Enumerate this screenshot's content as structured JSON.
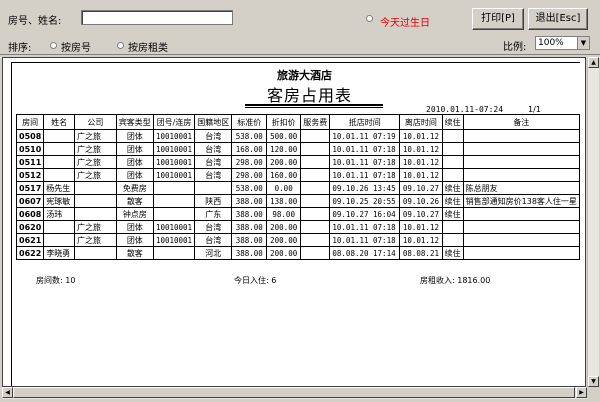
{
  "search": {
    "label": "房号、姓名:",
    "value": ""
  },
  "birthday": {
    "label": "今天过生日"
  },
  "buttons": {
    "print": "打印[P]",
    "exit": "退出[Esc]"
  },
  "sort": {
    "label": "排序:",
    "options": [
      {
        "label": "按房号",
        "selected": false
      },
      {
        "label": "按房租类",
        "selected": false
      }
    ]
  },
  "zoom": {
    "label": "比例:",
    "value": "100%"
  },
  "report": {
    "hotel_name": "旅游大酒店",
    "title": "客房占用表",
    "print_time": "2010.01.11-07:24",
    "page": "1/1",
    "columns": [
      "房间",
      "姓名",
      "公司",
      "宾客类型",
      "团号/连房",
      "国籍地区",
      "标准价",
      "折扣价",
      "服务费",
      "抵店时间",
      "离店时间",
      "续住",
      "备注"
    ],
    "rows": [
      [
        "0508",
        "",
        "广之旅",
        "团体",
        "10010001",
        "台湾",
        "538.00",
        "500.00",
        "",
        "10.01.11 07:19",
        "10.01.12",
        "",
        ""
      ],
      [
        "0510",
        "",
        "广之旅",
        "团体",
        "10010001",
        "台湾",
        "168.00",
        "120.00",
        "",
        "10.01.11 07:18",
        "10.01.12",
        "",
        ""
      ],
      [
        "0511",
        "",
        "广之旅",
        "团体",
        "10010001",
        "台湾",
        "298.00",
        "200.00",
        "",
        "10.01.11 07:18",
        "10.01.12",
        "",
        ""
      ],
      [
        "0512",
        "",
        "广之旅",
        "团体",
        "10010001",
        "台湾",
        "298.00",
        "160.00",
        "",
        "10.01.11 07:18",
        "10.01.12",
        "",
        ""
      ],
      [
        "0517",
        "杨先生",
        "",
        "免费房",
        "",
        "",
        "538.00",
        "0.00",
        "",
        "09.10.26 13:45",
        "09.10.27",
        "续住",
        "陈总朋友"
      ],
      [
        "0607",
        "宪琢敏",
        "",
        "散客",
        "",
        "陕西",
        "388.00",
        "138.00",
        "",
        "09.10.25 20:55",
        "09.10.26",
        "续住",
        "销售部通知房价138客人住一星"
      ],
      [
        "0608",
        "汤玮",
        "",
        "钟点房",
        "",
        "广东",
        "388.00",
        "98.00",
        "",
        "09.10.27 16:04",
        "09.10.27",
        "续住",
        ""
      ],
      [
        "0620",
        "",
        "广之旅",
        "团体",
        "10010001",
        "台湾",
        "388.00",
        "200.00",
        "",
        "10.01.11 07:18",
        "10.01.12",
        "",
        ""
      ],
      [
        "0621",
        "",
        "广之旅",
        "团体",
        "10010001",
        "台湾",
        "388.00",
        "200.00",
        "",
        "10.01.11 07:18",
        "10.01.12",
        "",
        ""
      ],
      [
        "0622",
        "李晓勇",
        "",
        "散客",
        "",
        "河北",
        "388.00",
        "200.00",
        "",
        "08.08.20 17:14",
        "08.08.21",
        "续住",
        ""
      ]
    ],
    "summary": {
      "rooms": "房间数:  10",
      "today_checkin": "今日入住:  6",
      "revenue": "房租收入:   1816.00"
    }
  },
  "colors": {
    "background": "#d4d0c8",
    "birthday_text": "#e00000",
    "paper": "#ffffff"
  },
  "icons": {
    "zoom_dropdown": "chevron-down-icon",
    "scroll_up": "arrow-up-icon",
    "scroll_down": "arrow-down-icon",
    "scroll_left": "arrow-left-icon",
    "scroll_right": "arrow-right-icon"
  }
}
